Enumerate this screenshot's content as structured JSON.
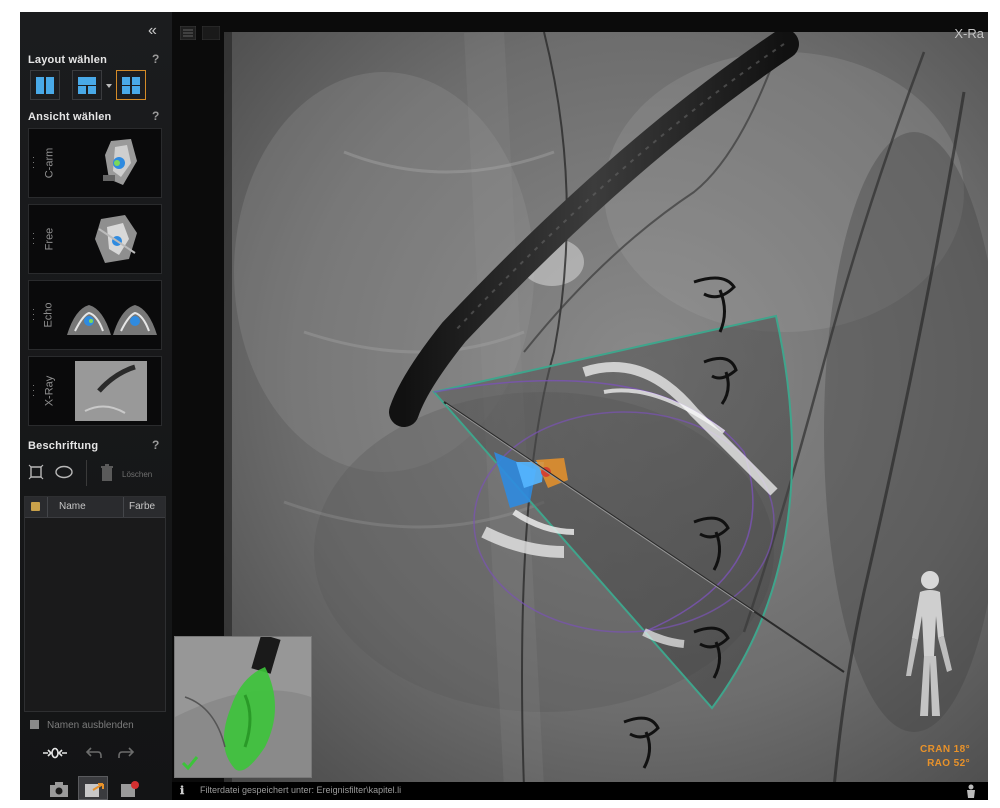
{
  "sidebar": {
    "layout_title": "Layout wählen",
    "help": "?",
    "view_title": "Ansicht wählen",
    "views": [
      {
        "label": "C-arm"
      },
      {
        "label": "Free"
      },
      {
        "label": "Echo"
      },
      {
        "label": "X-Ray"
      }
    ],
    "annotation_title": "Beschriftung",
    "delete_label": "Löschen",
    "table": {
      "col_name": "Name",
      "col_color": "Farbe"
    },
    "hide_names": "Namen ausblenden"
  },
  "viewport": {
    "title": "X-Ra",
    "angles": {
      "cran": "CRAN  18°",
      "rao": "RAO  52°"
    },
    "status": "Filterdatei gespeichert unter: Ereignisfilter\\kapitel.li"
  },
  "colors": {
    "accent": "#d48b28",
    "tile": "#49a9e8",
    "angle_text": "#e8922a",
    "device_green": "#3cc43a",
    "fan_outline": "#3fa58c"
  },
  "icons": [
    "collapse-icon",
    "layout-two-column-icon",
    "layout-split-icon",
    "layout-quad-icon",
    "rectangle-select-icon",
    "ellipse-select-icon",
    "trash-icon",
    "checkmark-icon",
    "undo-icon",
    "redo-icon",
    "camera-icon",
    "export-icon",
    "record-icon",
    "info-icon",
    "person-orientation-icon"
  ]
}
